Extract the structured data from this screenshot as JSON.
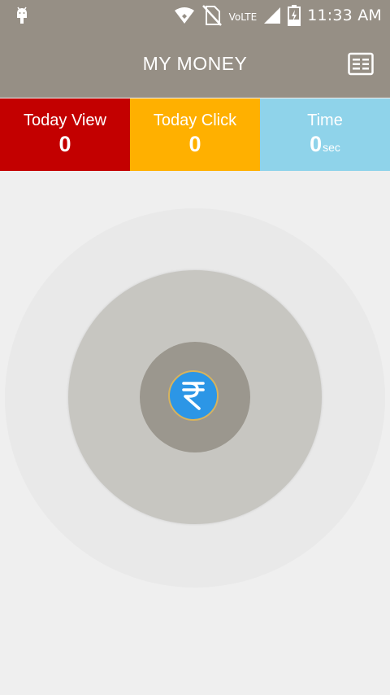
{
  "status_bar": {
    "network_label": "VoLTE",
    "time": "11:33 AM",
    "icons": [
      "android-debug-icon",
      "wifi-icon",
      "no-sim-icon",
      "signal-icon",
      "battery-charging-icon"
    ]
  },
  "app_bar": {
    "title": "MY MONEY",
    "menu_icon": "list-menu-icon"
  },
  "stats": {
    "today_view": {
      "label": "Today View",
      "value": "0",
      "color": "#c30000"
    },
    "today_click": {
      "label": "Today Click",
      "value": "0",
      "color": "#ffb000"
    },
    "time": {
      "label": "Time",
      "value": "0",
      "unit": "sec",
      "color": "#8fd3ea"
    }
  },
  "center": {
    "icon": "rupee-icon",
    "button_color": "#2c96e6"
  }
}
